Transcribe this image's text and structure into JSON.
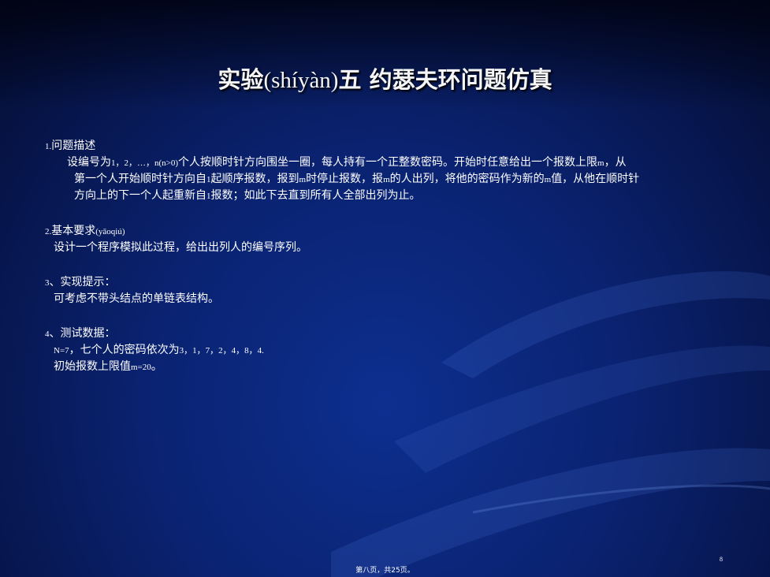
{
  "title": {
    "part1": "实验",
    "pinyin": "(shíyàn)",
    "part2": "五 约瑟夫环问题仿真"
  },
  "sections": {
    "s1": {
      "num": "1.",
      "heading": "问题描述",
      "line1_a": "设编号为",
      "line1_b": "1，2，…，n(n>0)",
      "line1_c": "个人按顺时针方向围坐一圈，每人持有一个正整数密码。开始时任意给出一个报数上限",
      "line1_d": "m",
      "line1_e": "，从",
      "line2_a": "第一个人开始顺时针方向自",
      "line2_b": "1",
      "line2_c": "起顺序报数，报到",
      "line2_d": "m",
      "line2_e": "时停止报数，报",
      "line2_f": "m",
      "line2_g": "的人出列，将他的密码作为新的",
      "line2_h": "m",
      "line2_i": "值，从他在顺时针",
      "line3_a": "方向上的下一个人起重新自",
      "line3_b": "1",
      "line3_c": "报数；如此下去直到所有人全部出列为止。"
    },
    "s2": {
      "num": "2.",
      "heading": "基本要求",
      "pinyin": "(yāoqiú)",
      "body": "设计一个程序模拟此过程，给出出列人的编号序列。"
    },
    "s3": {
      "num": "3",
      "heading": "、实现提示：",
      "body": "可考虑不带头结点的单链表结构。"
    },
    "s4": {
      "num": "4",
      "heading": "、测试数据：",
      "line1_a": "N=7",
      "line1_b": "，七个人的密码依次为",
      "line1_c": "3，1，7，2，4，8，4.",
      "line2_a": "初始报数上限值",
      "line2_b": "m=20",
      "line2_c": "。"
    }
  },
  "slide_number": "8",
  "footer": "第八页，共25页。",
  "colors": {
    "background": "#0a2270",
    "text": "#ffffff"
  }
}
